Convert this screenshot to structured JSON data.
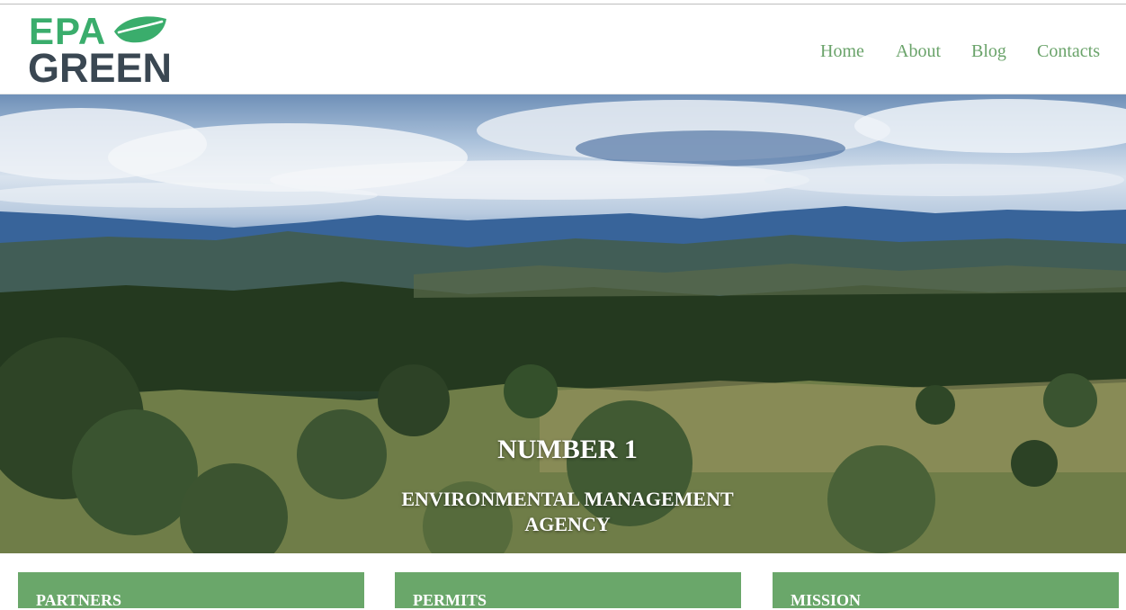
{
  "logo": {
    "line1": "EPA",
    "line2": "GREEN",
    "icon": "leaf-icon",
    "colors": {
      "epa": "#3aad6c",
      "green": "#3a4752",
      "leaf": "#3aad6c"
    }
  },
  "nav": {
    "items": [
      {
        "label": "Home"
      },
      {
        "label": "About"
      },
      {
        "label": "Blog"
      },
      {
        "label": "Contacts"
      }
    ],
    "color": "#6aa36a"
  },
  "hero": {
    "title": "NUMBER 1",
    "subtitle": "ENVIRONMENTAL MANAGEMENT AGENCY",
    "image": "landscape-hills-forest-sky"
  },
  "cards": [
    {
      "title": "PARTNERS"
    },
    {
      "title": "PERMITS"
    },
    {
      "title": "MISSION"
    }
  ],
  "accent_color": "#6aa76a"
}
